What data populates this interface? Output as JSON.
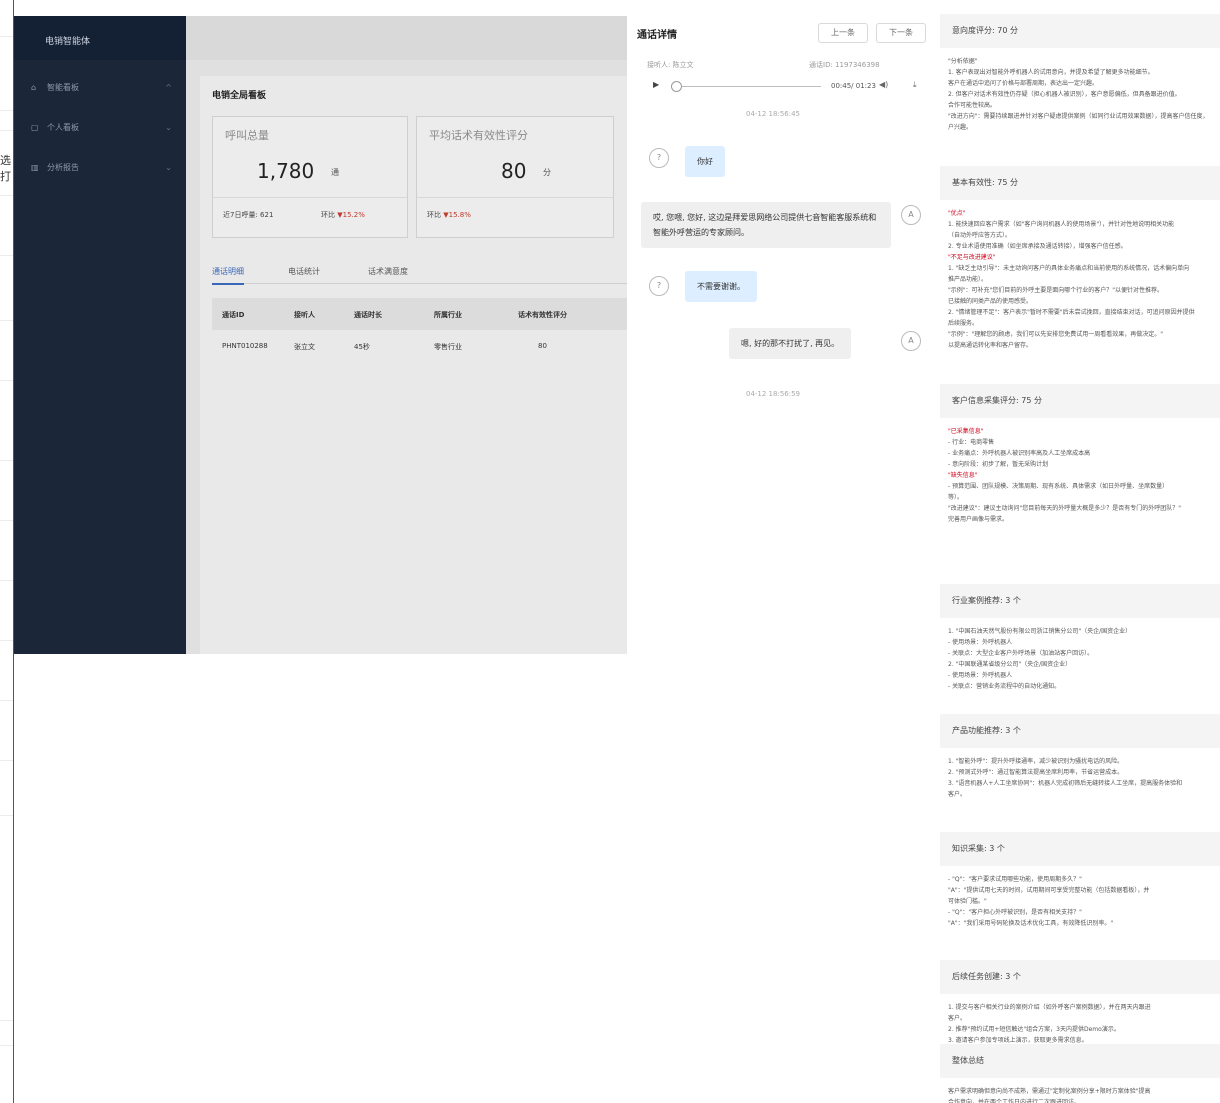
{
  "left_strip": {
    "cut_text": "选打"
  },
  "dashboard": {
    "brand": "电销智能体",
    "sidebar": [
      {
        "label": "智能看板",
        "icon": "home-icon"
      },
      {
        "label": "个人看板",
        "icon": "user-icon"
      },
      {
        "label": "分析报告",
        "icon": "chart-icon"
      }
    ],
    "title": "电销全局看板",
    "cards": [
      {
        "label": "呼叫总量",
        "value": "1,780",
        "unit": "通",
        "foot_left": "近7日呼量: 621",
        "foot_right_prefix": "环比",
        "foot_right_value": "▼15.2%"
      },
      {
        "label": "平均话术有效性评分",
        "value": "80",
        "unit": "分",
        "foot_left": "",
        "foot_right_prefix": "环比",
        "foot_right_value": "▼15.8%"
      }
    ],
    "tabs": [
      "通话明细",
      "电话统计",
      "话术满意度"
    ],
    "table": {
      "headers": [
        "通话ID",
        "接听人",
        "通话时长",
        "所属行业",
        "话术有效性评分"
      ],
      "rows": [
        [
          "PHNT010288",
          "张立文",
          "45秒",
          "零售行业",
          "80"
        ]
      ]
    }
  },
  "call_detail": {
    "title": "通话详情",
    "prev_label": "上一条",
    "next_label": "下一条",
    "callee": "接听人: 陈立文",
    "phone": "通话ID: 1197346398",
    "audio_time": "00:45/ 01:23",
    "timestamps": [
      "04-12 18:56:45",
      "04-12 18:56:59"
    ],
    "messages": [
      {
        "side": "left",
        "text": "你好"
      },
      {
        "side": "right",
        "text": "哎, 您喂, 您好, 这边是拜爱思网络公司提供七音智能客服系统和智能外呼营运的专家顾问。"
      },
      {
        "side": "left",
        "text": "不需要谢谢。"
      },
      {
        "side": "right",
        "text": "嗯, 好的那不打扰了, 再见。"
      }
    ]
  },
  "evaluation": {
    "sections": [
      {
        "title": "意向度评分: 70 分",
        "lines": [
          {
            "t": "\"分析依据\"",
            "red": false
          },
          {
            "t": "1. 客户表现出对智能外呼机器人的试用意向，并提及希望了解更多功能细节。",
            "red": false
          },
          {
            "t": "客户在通话中追问了价格与部署周期，表达出一定兴趣。",
            "red": false
          },
          {
            "t": "2. 但客户对话术有效性仍存疑（担心机器人被识别），客户意愿偏低，但具备跟进价值。",
            "red": false
          },
          {
            "t": "合作可能性较高。",
            "red": false
          },
          {
            "t": "\"改进方向\"：需要持续跟进并针对客户疑虑提供案例（如同行业试用效果数据），提高客户信任度，",
            "red": false
          },
          {
            "t": "户兴趣。",
            "red": false
          }
        ]
      },
      {
        "title": "基本有效性: 75 分",
        "lines": [
          {
            "t": "\"优点\"",
            "red": true
          },
          {
            "t": "1. 能快速回应客户需求（如\"客户询问机器人的使用场景\"），并针对性地说明相关功能",
            "red": false
          },
          {
            "t": "（自动外呼应答方式）。",
            "red": false
          },
          {
            "t": "2. 专业术语使用准确（如坐席承接及通话转接），增强客户信任感。",
            "red": false
          },
          {
            "t": "\"不足与改进建议\"",
            "red": true
          },
          {
            "t": "1. \"缺乏主动引导\"：未主动询问客户的具体业务痛点和当前使用的系统情况，话术偏向单向",
            "red": false
          },
          {
            "t": "推产品功能）。",
            "red": false
          },
          {
            "t": "\"示例\"：可补充\"您们目前的外呼主要是面向哪个行业的客户？\"以便针对性推荐。",
            "red": false
          },
          {
            "t": "已接触的同类产品的使用感受。",
            "red": false
          },
          {
            "t": "2. \"情绪管理不足\"：客户表示\"暂时不需要\"后未尝试挽回，直接结束对话，可追问原因并提供",
            "red": false
          },
          {
            "t": "后续服务。",
            "red": false
          },
          {
            "t": "\"示例\"：\"理解您的顾虑，我们可以先安排您免费试用一周看看效果，再做决定。\"",
            "red": false
          },
          {
            "t": "以提高通话转化率和客户留存。",
            "red": false
          }
        ]
      },
      {
        "title": "客户信息采集评分: 75 分",
        "lines": [
          {
            "t": "\"已采集信息\"",
            "red": true
          },
          {
            "t": "- 行业：电商零售",
            "red": false
          },
          {
            "t": "- 业务痛点：外呼机器人被识别率高及人工坐席成本高",
            "red": false
          },
          {
            "t": "- 意向阶段：初步了解，暂无采购计划",
            "red": false
          },
          {
            "t": "\"缺失信息\"",
            "red": true
          },
          {
            "t": "- 预算范围、团队规模、决策周期、现有系统、具体需求（如日外呼量、坐席数量）",
            "red": false
          },
          {
            "t": "等）。",
            "red": false
          },
          {
            "t": "\"改进建议\"：建议主动询问\"您目前每天的外呼量大概是多少？是否有专门的外呼团队？\"",
            "red": false
          },
          {
            "t": "完善用户画像与需求。",
            "red": false
          }
        ]
      },
      {
        "title": "行业案例推荐: 3 个",
        "lines": [
          {
            "t": "1. \"中国石油天然气股份有限公司浙江销售分公司\"（央企/国资企业）",
            "red": false
          },
          {
            "t": "- 使用场景：外呼机器人",
            "red": false
          },
          {
            "t": "- 关联点：大型企业客户外呼场景（加油站客户回访）。",
            "red": false
          },
          {
            "t": "2. \"中国联通某省级分公司\"（央企/国资企业）",
            "red": false
          },
          {
            "t": "- 使用场景：外呼机器人",
            "red": false
          },
          {
            "t": "- 关联点：营销业务流程中的自动化通知。",
            "red": false
          }
        ]
      },
      {
        "title": "产品功能推荐: 3 个",
        "lines": [
          {
            "t": "1. \"智能外呼\"：提升外呼接通率，减少被识别为骚扰电话的风险。",
            "red": false
          },
          {
            "t": "2. \"预测式外呼\"：通过智能算法提高坐席利用率，节省运营成本。",
            "red": false
          },
          {
            "t": "3. \"语音机器人+人工坐席协同\"：机器人完成初筛后无缝转接人工坐席，提高服务体验和",
            "red": false
          },
          {
            "t": "客户。",
            "red": false
          }
        ]
      },
      {
        "title": "知识采集: 3 个",
        "lines": [
          {
            "t": "- \"Q\"：\"客户要求试用哪些功能，使用周期多久？\"",
            "red": false
          },
          {
            "t": "\"A\"：\"提供试用七天的时间，试用期间可享受完整功能（包括数据看板），并",
            "red": false
          },
          {
            "t": "可体验门槛。\"",
            "red": false
          },
          {
            "t": "- \"Q\"：\"客户担心外呼被识别，是否有相关支持？\"",
            "red": false
          },
          {
            "t": "\"A\"：\"我们采用号码轮换及话术优化工具，有效降低识别率。\"",
            "red": false
          }
        ]
      },
      {
        "title": "后续任务创建: 3 个",
        "lines": [
          {
            "t": "1. 提交与客户相关行业的案例介绍（如外呼客户案例数据），并在两天内跟进",
            "red": false
          },
          {
            "t": "客户。",
            "red": false
          },
          {
            "t": "2. 推荐\"预约试用+短信触达\"组合方案，3天内提供Demo演示。",
            "red": false
          },
          {
            "t": "3. 邀请客户参加专项线上演示，获取更多需求信息。",
            "red": false
          }
        ]
      },
      {
        "title": "整体总结",
        "lines": [
          {
            "t": "客户需求明确但意向尚不成熟，需通过\"定制化案例分享+限时方案体验\"提高",
            "red": false
          },
          {
            "t": "合作意向，并在两个工作日内进行二次跟进回访。",
            "red": false
          }
        ]
      }
    ]
  }
}
